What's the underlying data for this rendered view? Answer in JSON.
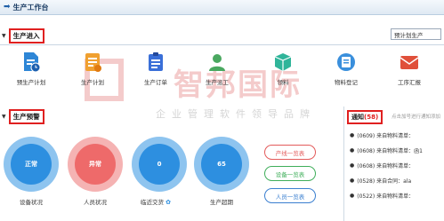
{
  "header": {
    "title": "生产工作台"
  },
  "entry": {
    "title": "生产进入",
    "plan_select": "预计划生产",
    "tiles": [
      {
        "label": "预生产计划",
        "icon": "pre-plan-doc-icon",
        "color": "#2e86d6"
      },
      {
        "label": "生产计划",
        "icon": "production-plan-icon",
        "color": "#f0a030"
      },
      {
        "label": "生产订单",
        "icon": "production-order-icon",
        "color": "#3a6fd8"
      },
      {
        "label": "生产派工",
        "icon": "dispatch-icon",
        "color": "#4aa860"
      },
      {
        "label": "领料",
        "icon": "material-pick-icon",
        "color": "#30b59a"
      },
      {
        "label": "物料登记",
        "icon": "material-register-icon",
        "color": "#3a8fdc"
      },
      {
        "label": "工序汇报",
        "icon": "process-report-icon",
        "color": "#e0503a"
      }
    ]
  },
  "watermark": {
    "brand": "智邦国际",
    "slogan": "企业管理软件领导品牌"
  },
  "warning": {
    "title": "生产预警",
    "circles": [
      {
        "value": "正常",
        "label": "设备状况",
        "ring": "#8ec4ef",
        "fill": "#2d8fe0"
      },
      {
        "value": "异常",
        "label": "人员状况",
        "ring": "#f5b3b3",
        "fill": "#ee6a6a"
      },
      {
        "value": "0",
        "label": "临近交货",
        "ring": "#8ec4ef",
        "fill": "#2d8fe0"
      },
      {
        "value": "65",
        "label": "生产超期",
        "ring": "#8ec4ef",
        "fill": "#2d8fe0"
      }
    ],
    "buttons": [
      {
        "label": "产线一览表",
        "color": "#e35a5a"
      },
      {
        "label": "设备一览表",
        "color": "#3fae5a"
      },
      {
        "label": "人员一览表",
        "color": "#3a7fd0"
      }
    ]
  },
  "notice": {
    "title": "通知",
    "count": "(58)",
    "hint": "点击加号进行通知添加",
    "items": [
      "(0609) 来自物料清单：",
      "(0608) 来自物料清单：函1",
      "(0608) 来自物料清单：",
      "(0528) 来自合同：ala",
      "(0522) 来自物料清单："
    ]
  }
}
